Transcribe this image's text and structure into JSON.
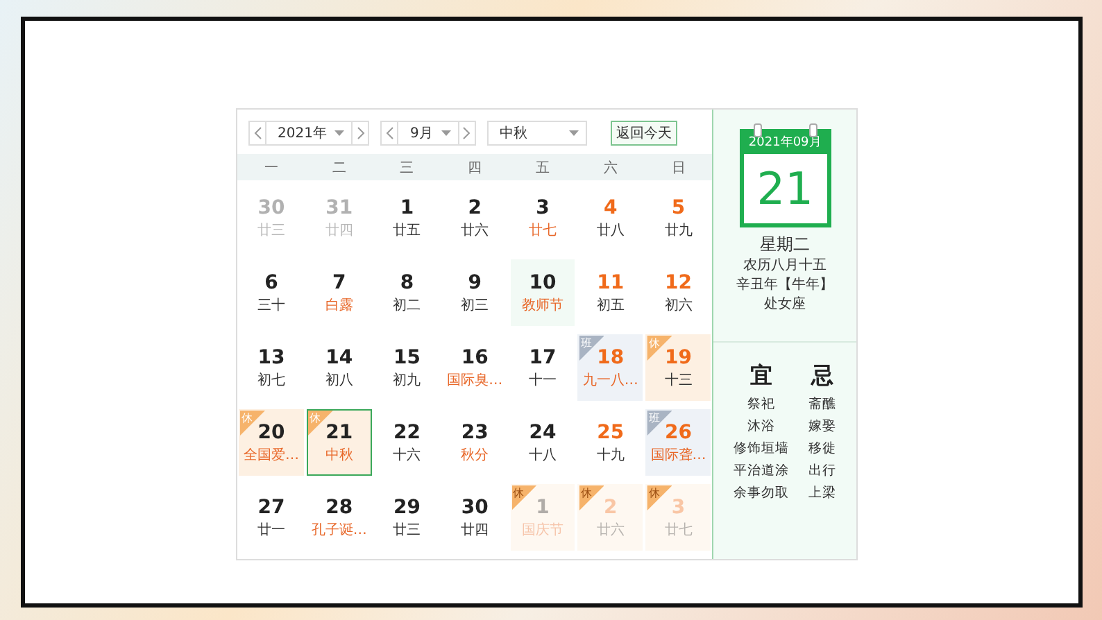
{
  "toolbar": {
    "year": "2021年",
    "month": "9月",
    "holiday": "中秋",
    "today_button": "返回今天"
  },
  "weekdays": [
    "一",
    "二",
    "三",
    "四",
    "五",
    "六",
    "日"
  ],
  "days": [
    {
      "day": "30",
      "lunar": "廿三",
      "kind": "prev",
      "weekend": false,
      "festival": false
    },
    {
      "day": "31",
      "lunar": "廿四",
      "kind": "prev",
      "weekend": false,
      "festival": false
    },
    {
      "day": "1",
      "lunar": "廿五",
      "kind": "current",
      "weekend": false,
      "festival": false
    },
    {
      "day": "2",
      "lunar": "廿六",
      "kind": "current",
      "weekend": false,
      "festival": false
    },
    {
      "day": "3",
      "lunar": "廿七",
      "kind": "current",
      "weekend": false,
      "festival": true
    },
    {
      "day": "4",
      "lunar": "廿八",
      "kind": "current",
      "weekend": true,
      "festival": false
    },
    {
      "day": "5",
      "lunar": "廿九",
      "kind": "current",
      "weekend": true,
      "festival": false
    },
    {
      "day": "6",
      "lunar": "三十",
      "kind": "current",
      "weekend": false,
      "festival": false
    },
    {
      "day": "7",
      "lunar": "白露",
      "kind": "current",
      "weekend": false,
      "festival": true
    },
    {
      "day": "8",
      "lunar": "初二",
      "kind": "current",
      "weekend": false,
      "festival": false
    },
    {
      "day": "9",
      "lunar": "初三",
      "kind": "current",
      "weekend": false,
      "festival": false
    },
    {
      "day": "10",
      "lunar": "教师节",
      "kind": "current",
      "weekend": false,
      "festival": true,
      "hovered": true
    },
    {
      "day": "11",
      "lunar": "初五",
      "kind": "current",
      "weekend": true,
      "festival": false
    },
    {
      "day": "12",
      "lunar": "初六",
      "kind": "current",
      "weekend": true,
      "festival": false
    },
    {
      "day": "13",
      "lunar": "初七",
      "kind": "current",
      "weekend": false,
      "festival": false
    },
    {
      "day": "14",
      "lunar": "初八",
      "kind": "current",
      "weekend": false,
      "festival": false
    },
    {
      "day": "15",
      "lunar": "初九",
      "kind": "current",
      "weekend": false,
      "festival": false
    },
    {
      "day": "16",
      "lunar": "国际臭…",
      "kind": "current",
      "weekend": false,
      "festival": true
    },
    {
      "day": "17",
      "lunar": "十一",
      "kind": "current",
      "weekend": false,
      "festival": false
    },
    {
      "day": "18",
      "lunar": "九一八…",
      "kind": "current",
      "weekend": true,
      "festival": true,
      "badge": {
        "kind": "work",
        "text": "班"
      }
    },
    {
      "day": "19",
      "lunar": "十三",
      "kind": "current",
      "weekend": true,
      "festival": false,
      "badge": {
        "kind": "rest",
        "text": "休"
      }
    },
    {
      "day": "20",
      "lunar": "全国爱…",
      "kind": "current",
      "weekend": false,
      "festival": true,
      "badge": {
        "kind": "rest",
        "text": "休"
      }
    },
    {
      "day": "21",
      "lunar": "中秋",
      "kind": "current",
      "weekend": false,
      "festival": true,
      "selected": true,
      "badge": {
        "kind": "rest",
        "text": "休"
      }
    },
    {
      "day": "22",
      "lunar": "十六",
      "kind": "current",
      "weekend": false,
      "festival": false
    },
    {
      "day": "23",
      "lunar": "秋分",
      "kind": "current",
      "weekend": false,
      "festival": true
    },
    {
      "day": "24",
      "lunar": "十八",
      "kind": "current",
      "weekend": false,
      "festival": false
    },
    {
      "day": "25",
      "lunar": "十九",
      "kind": "current",
      "weekend": true,
      "festival": false
    },
    {
      "day": "26",
      "lunar": "国际聋…",
      "kind": "current",
      "weekend": true,
      "festival": true,
      "badge": {
        "kind": "work",
        "text": "班"
      }
    },
    {
      "day": "27",
      "lunar": "廿一",
      "kind": "current",
      "weekend": false,
      "festival": false
    },
    {
      "day": "28",
      "lunar": "孔子诞…",
      "kind": "current",
      "weekend": false,
      "festival": true
    },
    {
      "day": "29",
      "lunar": "廿三",
      "kind": "current",
      "weekend": false,
      "festival": false
    },
    {
      "day": "30",
      "lunar": "廿四",
      "kind": "current",
      "weekend": false,
      "festival": false
    },
    {
      "day": "1",
      "lunar": "国庆节",
      "kind": "next",
      "weekend": false,
      "festival": true,
      "badge": {
        "kind": "rest",
        "text": "休"
      }
    },
    {
      "day": "2",
      "lunar": "廿六",
      "kind": "next",
      "weekend": true,
      "festival": false,
      "badge": {
        "kind": "rest",
        "text": "休"
      }
    },
    {
      "day": "3",
      "lunar": "廿七",
      "kind": "next",
      "weekend": true,
      "festival": false,
      "badge": {
        "kind": "rest",
        "text": "休"
      }
    }
  ],
  "detail": {
    "month_label": "2021年09月",
    "day": "21",
    "weekday": "星期二",
    "lunar_date": "农历八月十五",
    "ganzhi": "辛丑年【牛年】",
    "zodiac": "处女座"
  },
  "almanac": {
    "good_title": "宜",
    "good": [
      "祭祀",
      "沐浴",
      "修饰垣墙",
      "平治道涂",
      "余事勿取"
    ],
    "bad_title": "忌",
    "bad": [
      "斋醮",
      "嫁娶",
      "移徙",
      "出行",
      "上梁"
    ]
  }
}
